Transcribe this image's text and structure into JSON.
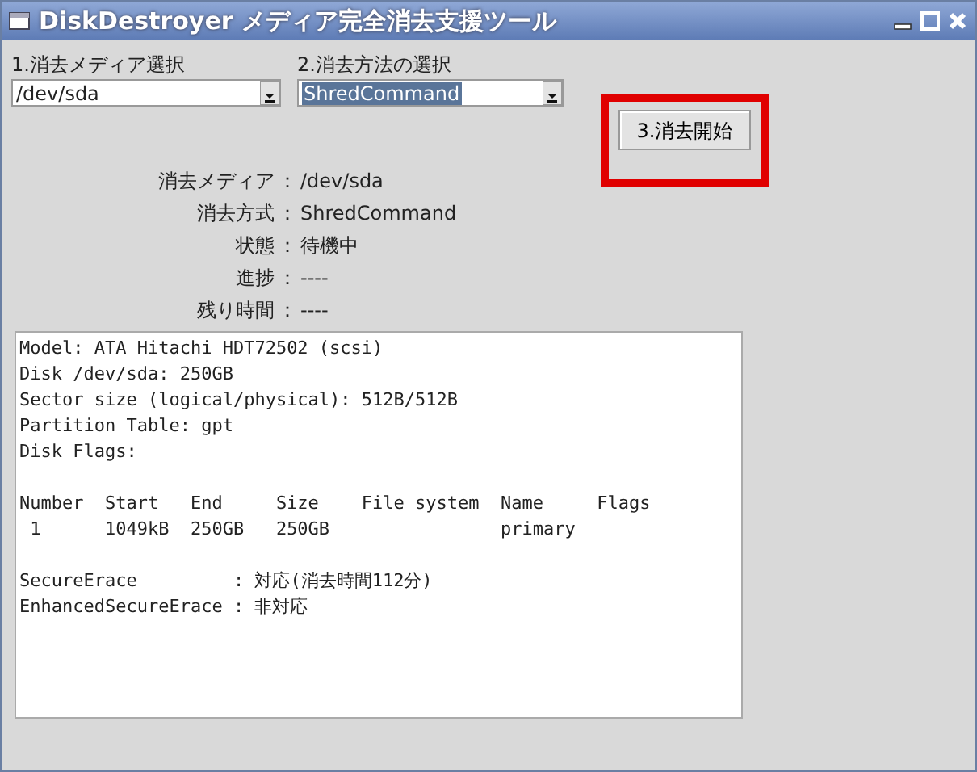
{
  "window": {
    "title": "DiskDestroyer メディア完全消去支援ツール"
  },
  "media_select": {
    "label": "1.消去メディア選択",
    "value": "/dev/sda",
    "selected_text": false
  },
  "method_select": {
    "label": "2.消去方法の選択",
    "value": "ShredCommand",
    "selected_text": true
  },
  "start_button": {
    "label": "3.消去開始",
    "highlighted": true
  },
  "info": [
    {
      "label": "消去メディア",
      "colon": "：",
      "value": "/dev/sda"
    },
    {
      "label": "消去方式",
      "colon": "：",
      "value": "ShredCommand"
    },
    {
      "label": "状態",
      "colon": "：",
      "value": "待機中"
    },
    {
      "label": "進捗",
      "colon": "：",
      "value": "----"
    },
    {
      "label": "残り時間",
      "colon": "：",
      "value": "----"
    }
  ],
  "output": {
    "sections": [
      [
        "Model: ATA Hitachi HDT72502 (scsi)",
        "Disk /dev/sda: 250GB",
        "Sector size (logical/physical): 512B/512B",
        "Partition Table: gpt",
        "Disk Flags:"
      ],
      [
        "Number  Start   End     Size    File system  Name     Flags",
        " 1      1049kB  250GB   250GB                primary"
      ],
      [
        "SecureErace         : 対応(消去時間112分)",
        "EnhancedSecureErace : 非対応"
      ]
    ]
  }
}
